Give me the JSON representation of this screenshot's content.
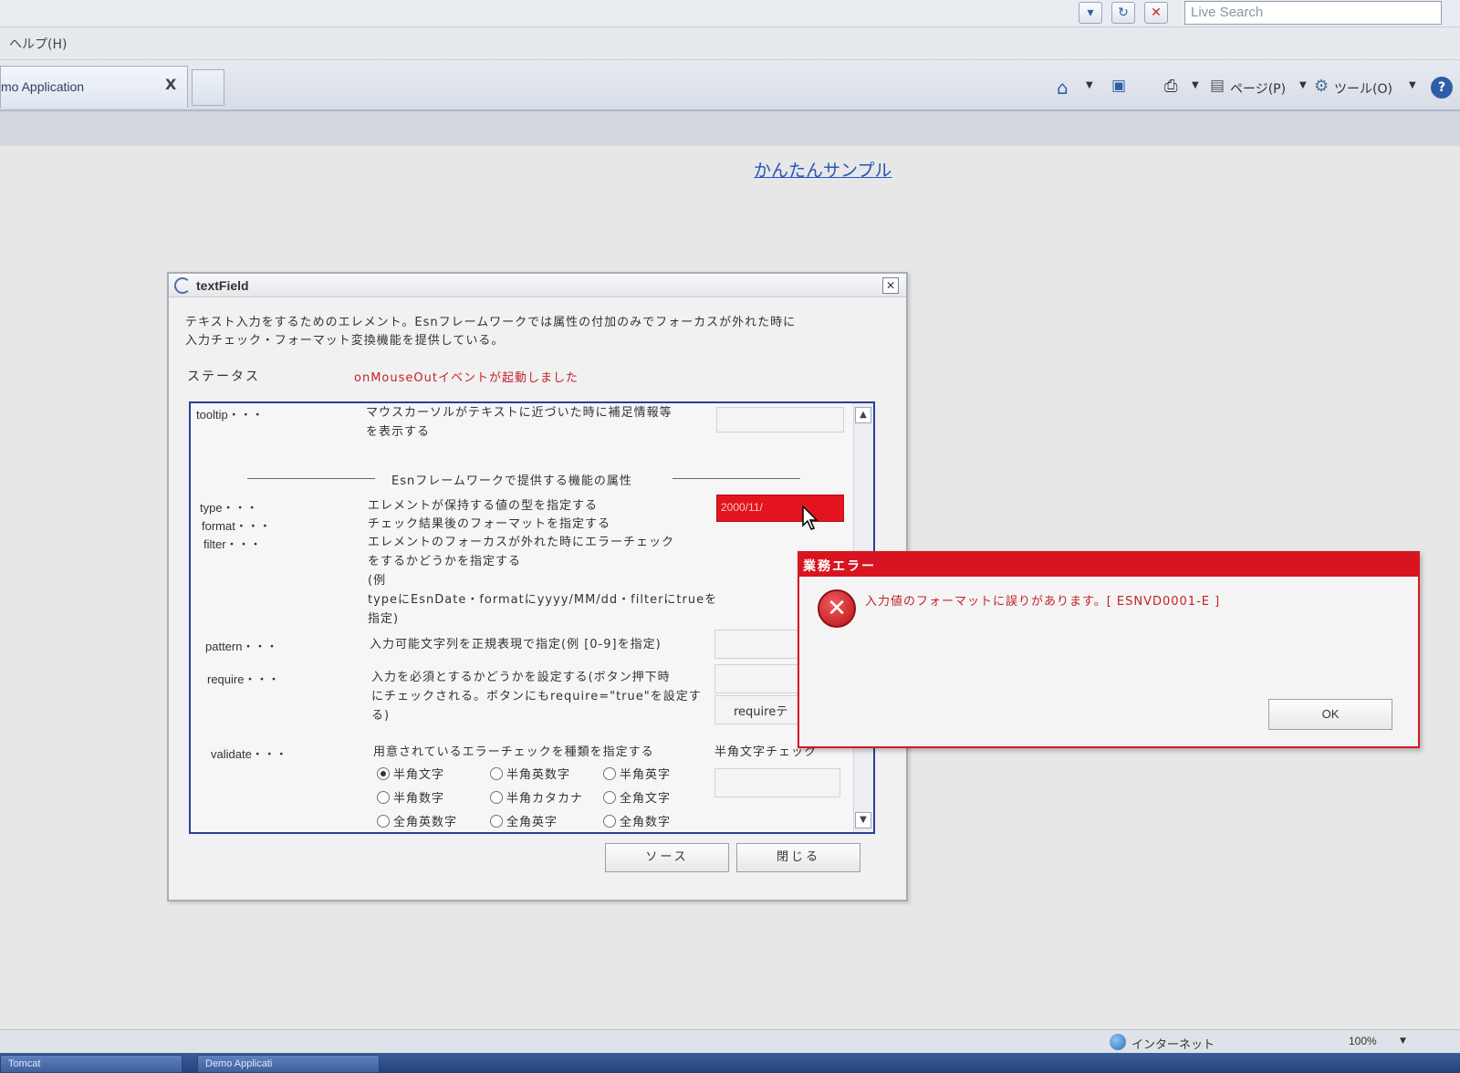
{
  "browser": {
    "search_placeholder": "Live Search",
    "menu_help": "ヘルプ(H)",
    "tab_title": "mo Application",
    "tab_close": "X",
    "toolbar": {
      "page_label": "ページ(P)",
      "tools_label": "ツール(O)",
      "help_glyph": "?"
    }
  },
  "page": {
    "link_text": "かんたんサンプル"
  },
  "textfield_dialog": {
    "title": "textField",
    "close_glyph": "✕",
    "description_line1": "テキスト入力をするためのエレメント。Esnフレームワークでは属性の付加のみでフォーカスが外れた時に",
    "description_line2": "入力チェック・フォーマット変換機能を提供している。",
    "status_label": "ステータス",
    "status_value": "onMouseOutイベントが起動しました",
    "section_title": "Esnフレームワークで提供する機能の属性",
    "attributes": {
      "tooltip": {
        "label": "tooltip・・・",
        "desc1": "マウスカーソルがテキストに近づいた時に補足情報等",
        "desc2": "を表示する"
      },
      "type": {
        "label": "type・・・",
        "desc": "エレメントが保持する値の型を指定する",
        "input_value": "2000/11/"
      },
      "format": {
        "label": "format・・・",
        "desc": "チェック結果後のフォーマットを指定する"
      },
      "filter": {
        "label": "filter・・・",
        "desc1": "エレメントのフォーカスが外れた時にエラーチェック",
        "desc2": "をするかどうかを指定する",
        "desc3": "(例",
        "desc4": "typeにEsnDate・formatにyyyy/MM/dd・filterにtrueを",
        "desc5": "指定)"
      },
      "pattern": {
        "label": "pattern・・・",
        "desc": "入力可能文字列を正規表現で指定(例 [0-9]を指定)"
      },
      "require": {
        "label": "require・・・",
        "desc1": "入力を必須とするかどうかを設定する(ボタン押下時",
        "desc2": "にチェックされる。ボタンにもrequire=\"true\"を設定す",
        "desc3": "る)",
        "button_text": "requireテ"
      },
      "validate": {
        "label": "validate・・・",
        "desc": "用意されているエラーチェックを種類を指定する",
        "side_text": "半角文字チェック",
        "options": [
          "半角文字",
          "半角英数字",
          "半角英字",
          "半角数字",
          "半角カタカナ",
          "全角文字",
          "全角英数字",
          "全角英字",
          "全角数字"
        ],
        "selected": "半角文字"
      }
    },
    "source_button": "ソース",
    "close_button": "閉じる"
  },
  "error_dialog": {
    "title": "業務エラー",
    "icon_glyph": "✕",
    "message": "入力値のフォーマットに誤りがあります。[ ESNVD0001-E ]",
    "ok_label": "OK"
  },
  "statusbar": {
    "zone": "インターネット",
    "zoom": "100%"
  },
  "taskbar": {
    "item1": "Tomcat",
    "item2": "Demo Applicati"
  },
  "colors": {
    "error_red": "#d81420",
    "link_blue": "#2456b8",
    "panel_border": "#2b3f9a"
  }
}
